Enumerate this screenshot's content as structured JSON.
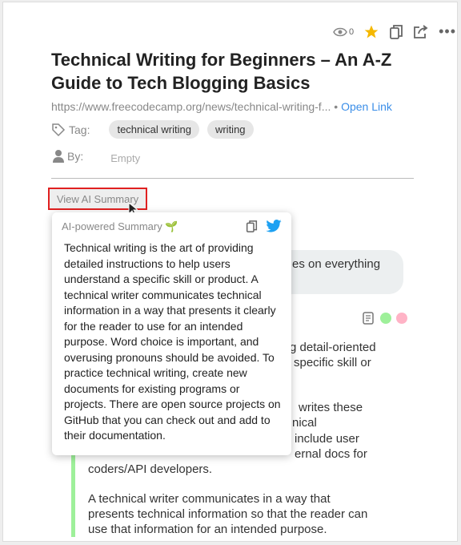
{
  "toolbar": {
    "views": "0",
    "icons": [
      "eye-icon",
      "star-icon",
      "copy-icon",
      "share-icon",
      "more-icon"
    ],
    "star_color": "#f5b800"
  },
  "title": "Technical Writing for Beginners – An A-Z Guide to Tech Blogging Basics",
  "url": "https://www.freecodecamp.org/news/technical-writing-f...",
  "open_link": "Open Link",
  "tag_label": "Tag:",
  "tags": [
    "technical writing",
    "writing"
  ],
  "by_label": "By:",
  "by_value": "Empty",
  "ai_button": "View AI Summary",
  "popup": {
    "heading": "AI-powered Summary",
    "sprout": "🌱",
    "twitter_color": "#1da1f2",
    "text": "Technical writing is the art of providing detailed instructions to help users understand a specific skill or product. A technical writer communicates technical information in a way that presents it clearly for the reader to use for an intended purpose. Word choice is important, and overusing pronouns should be avoided. To practice technical writing, create new documents for existing programs or projects. There are open source projects on GitHub that you can check out and add to their documentation."
  },
  "background": {
    "fragments": [
      "es on everything",
      "g detail-oriented",
      "specific skill or",
      "writes these",
      "nical",
      "include user",
      "ernal docs for"
    ],
    "lines": [
      "coders/API developers.",
      "A technical writer communicates in a way that",
      "presents technical information so that the reader can",
      "use that information for an intended purpose."
    ]
  },
  "colors": {
    "highlight_green": "#9ef09a",
    "highlight_pink": "#ffb3c6",
    "accent": "#3b8ee8"
  }
}
